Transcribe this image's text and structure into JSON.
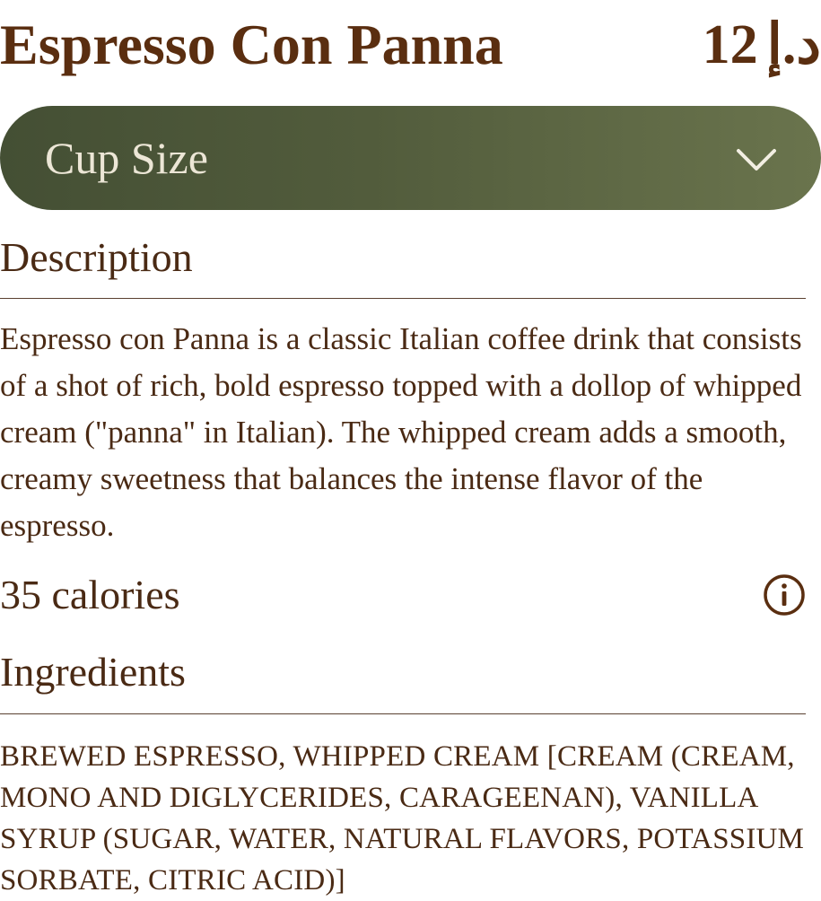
{
  "product": {
    "name": "Espresso Con Panna",
    "price_amount": "12",
    "price_currency": "د.إ"
  },
  "cup_size_select": {
    "label": "Cup Size",
    "icon": "chevron-down-icon"
  },
  "description": {
    "heading": "Description",
    "text": "Espresso con Panna is a classic Italian coffee drink that consists of a shot of rich, bold espresso topped with a dollop of whipped cream (\"panna\" in Italian). The whipped cream adds a smooth, creamy sweetness that balances the intense flavor of the espresso."
  },
  "nutrition": {
    "calories": "35 calories",
    "info_icon": "info-icon"
  },
  "ingredients": {
    "heading": "Ingredients",
    "text": "BREWED ESPRESSO, WHIPPED CREAM [CREAM (CREAM, MONO AND DIGLYCERIDES, CARAGEENAN), VANILLA SYRUP (SUGAR, WATER, NATURAL FLAVORS, POTASSIUM SORBATE, CITRIC ACID)]"
  },
  "colors": {
    "text_brown": "#5a2e10",
    "select_gradient_start": "#444f34",
    "select_gradient_end": "#6a744d",
    "select_text": "#ece6d6"
  }
}
